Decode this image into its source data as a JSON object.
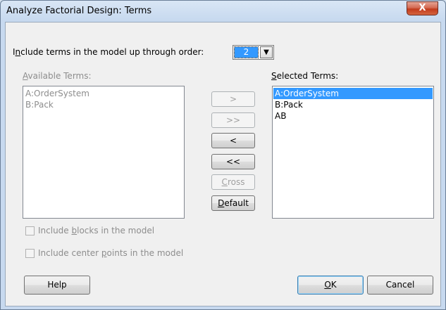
{
  "window": {
    "title": "Analyze Factorial Design: Terms",
    "close_glyph": "X"
  },
  "order": {
    "label_pre": "I",
    "label_u": "n",
    "label_post": "clude terms in the model up through order:",
    "value": "2",
    "arrow_icon": "▼"
  },
  "available": {
    "header_u": "A",
    "header_post": "vailable Terms:",
    "items": [
      "A:OrderSystem",
      "B:Pack"
    ]
  },
  "selected": {
    "header_u": "S",
    "header_post": "elected Terms:",
    "items": [
      "A:OrderSystem",
      "B:Pack",
      "AB"
    ]
  },
  "move_buttons": {
    "add": ">",
    "add_all": ">>",
    "remove": "<",
    "remove_all": "<<",
    "cross_u": "C",
    "cross_post": "ross",
    "default_u": "D",
    "default_post": "efault"
  },
  "options": {
    "blocks_pre": "Include ",
    "blocks_u": "b",
    "blocks_post": "locks in the model",
    "center_pre": "Include center ",
    "center_u": "p",
    "center_post": "oints in the model"
  },
  "footer": {
    "help": "Help",
    "ok_u": "O",
    "ok_post": "K",
    "cancel": "Cancel"
  }
}
